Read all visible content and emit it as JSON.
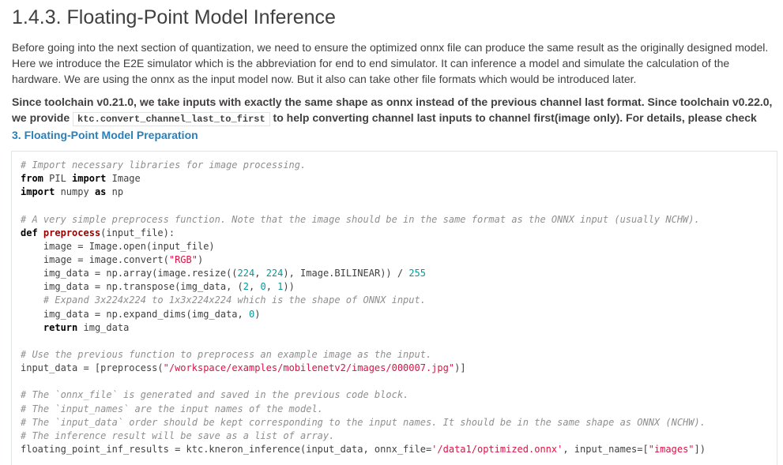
{
  "heading": "1.4.3. Floating-Point Model Inference",
  "intro_paragraph": "Before going into the next section of quantization, we need to ensure the optimized onnx file can produce the same result as the originally designed model. Here we introduce the E2E simulator which is the abbreviation for end to end simulator. It can inference a model and simulate the calculation of the hardware. We are using the onnx as the input model now. But it also can take other file formats which would be introduced later.",
  "note": {
    "text_before_code": "Since toolchain v0.21.0, we take inputs with exactly the same shape as onnx instead of the previous channel last format. Since toolchain v0.22.0, we provide ",
    "inline_code": "ktc.convert_channel_last_to_first",
    "text_after_code": " to help converting channel last inputs to channel first(image only). For details, please check ",
    "link_text": "3. Floating-Point Model Preparation"
  },
  "code_lines": [
    "# Import necessary libraries for image processing.",
    "from PIL import Image",
    "import numpy as np",
    "",
    "# A very simple preprocess function. Note that the image should be in the same format as the ONNX input (usually NCHW).",
    "def preprocess(input_file):",
    "    image = Image.open(input_file)",
    "    image = image.convert(\"RGB\")",
    "    img_data = np.array(image.resize((224, 224), Image.BILINEAR)) / 255",
    "    img_data = np.transpose(img_data, (2, 0, 1))",
    "    # Expand 3x224x224 to 1x3x224x224 which is the shape of ONNX input.",
    "    img_data = np.expand_dims(img_data, 0)",
    "    return img_data",
    "",
    "# Use the previous function to preprocess an example image as the input.",
    "input_data = [preprocess(\"/workspace/examples/mobilenetv2/images/000007.jpg\")]",
    "",
    "# The `onnx_file` is generated and saved in the previous code block.",
    "# The `input_names` are the input names of the model.",
    "# The `input_data` order should be kept corresponding to the input names. It should be in the same shape as ONNX (NCHW).",
    "# The inference result will be save as a list of array.",
    "floating_point_inf_results = ktc.kneron_inference(input_data, onnx_file='/data1/optimized.onnx', input_names=[\"images\"])"
  ]
}
